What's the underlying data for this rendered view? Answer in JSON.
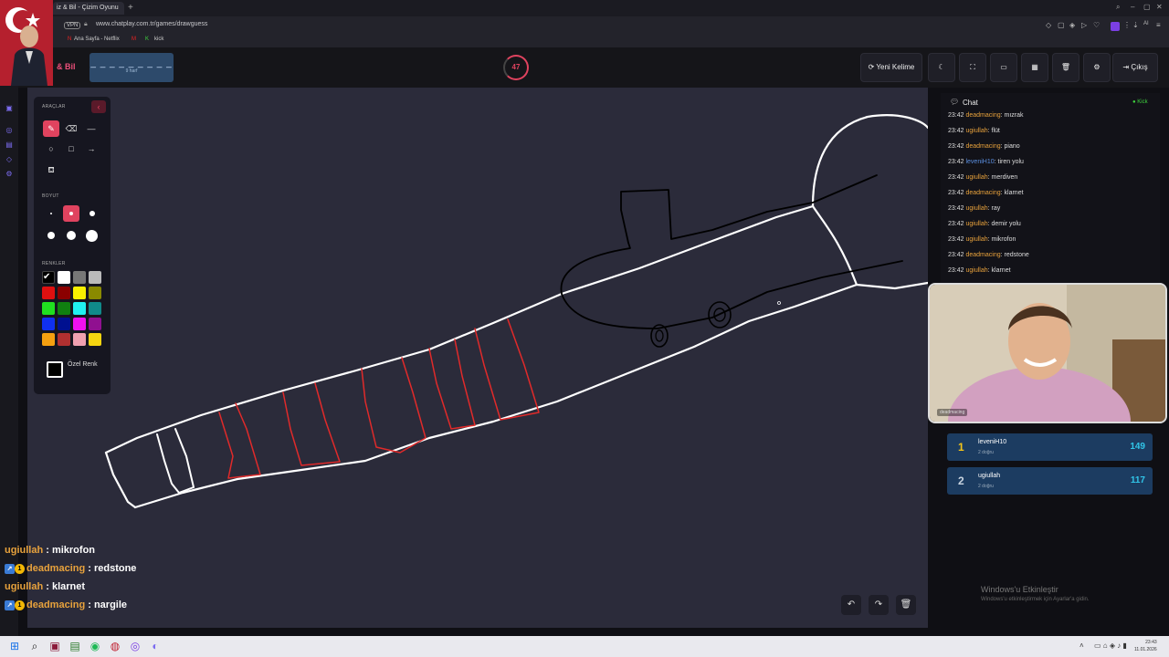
{
  "browser": {
    "tab_title": "iz & Bil - Çizim Oyunu",
    "vpn": "VPN",
    "url": "www.chatplay.com.tr/games/drawguess",
    "bookmarks": [
      "Ana Sayfa - Netflix",
      "kick"
    ],
    "toolbar_extra": "AI"
  },
  "header": {
    "logo": "& Bil",
    "word_mask": "_ _ _ _ _ _ _ _ _",
    "word_hint": "9 harf",
    "timer": "47",
    "new_word_label": "Yeni Kelime",
    "exit_label": "Çıkış"
  },
  "tools": {
    "title": "ARAÇLAR",
    "size_title": "BOYUT",
    "colors_title": "RENKLER",
    "custom_color_label": "Özel Renk",
    "colors": [
      "#000000",
      "#ffffff",
      "#777777",
      "#bbbbbb",
      "#e01010",
      "#8b0000",
      "#f7f000",
      "#8a8a00",
      "#20e020",
      "#108010",
      "#20f0f0",
      "#108a8a",
      "#1030f0",
      "#001090",
      "#f010f0",
      "#901090",
      "#f5a010",
      "#b03030",
      "#f0a0b0",
      "#f5d510"
    ]
  },
  "chat": {
    "title": "Chat",
    "status": "Kick",
    "messages": [
      {
        "time": "23:42",
        "user": "deadmacing",
        "text": "mızrak",
        "color": "orange"
      },
      {
        "time": "23:42",
        "user": "ugiullah",
        "text": "flüt",
        "color": "orange"
      },
      {
        "time": "23:42",
        "user": "deadmacing",
        "text": "piano",
        "color": "orange"
      },
      {
        "time": "23:42",
        "user": "leveniH10",
        "text": "tiren yolu",
        "color": "blue"
      },
      {
        "time": "23:42",
        "user": "ugiullah",
        "text": "merdiven",
        "color": "orange"
      },
      {
        "time": "23:42",
        "user": "deadmacing",
        "text": "klarnet",
        "color": "orange"
      },
      {
        "time": "23:42",
        "user": "ugiullah",
        "text": "ray",
        "color": "orange"
      },
      {
        "time": "23:42",
        "user": "ugiullah",
        "text": "demir yolu",
        "color": "orange"
      },
      {
        "time": "23:42",
        "user": "ugiullah",
        "text": "mikrofon",
        "color": "orange"
      },
      {
        "time": "23:42",
        "user": "deadmacing",
        "text": "redstone",
        "color": "orange"
      },
      {
        "time": "23:42",
        "user": "ugiullah",
        "text": "klarnet",
        "color": "orange"
      }
    ]
  },
  "webcam": {
    "name": "deadmacing"
  },
  "leaderboard": [
    {
      "rank": "1",
      "name": "leveniH10",
      "sub": "2 doğru",
      "score": "149",
      "rank_color": "#f5c518"
    },
    {
      "rank": "2",
      "name": "ugiullah",
      "sub": "2 doğru",
      "score": "117",
      "rank_color": "#c9d4e0"
    }
  ],
  "watermark": {
    "title": "Windows'u Etkinleştir",
    "sub": "Windows'u etkinleştirmek için Ayarlar'a gidin."
  },
  "overlay_chat": [
    {
      "user": "ugiullah",
      "text": " : mikrofon",
      "badges": false
    },
    {
      "user": "deadmacing",
      "text": " : redstone",
      "badges": true
    },
    {
      "user": "ugiullah",
      "text": " : klarnet",
      "badges": false
    },
    {
      "user": "deadmacing",
      "text": " : nargile",
      "badges": true
    }
  ],
  "clock": {
    "time": "23:43",
    "date": "11.01.2026"
  }
}
